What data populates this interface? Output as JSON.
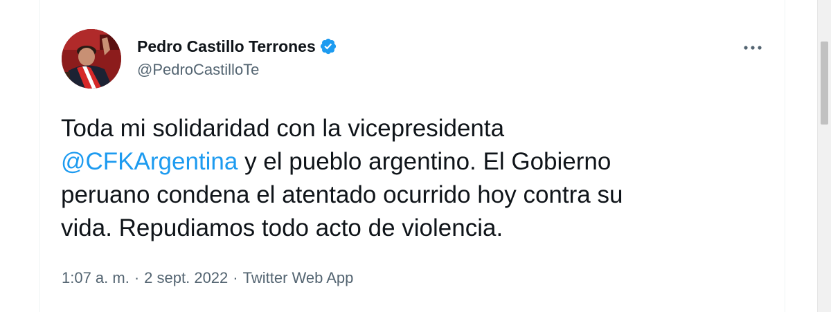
{
  "author": {
    "display_name": "Pedro Castillo Terrones",
    "handle": "@PedroCastilloTe",
    "verified": true
  },
  "tweet": {
    "text_line1": "Toda mi solidaridad con la vicepresidenta",
    "mention": "@CFKArgentina",
    "text_after_mention": " y el pueblo argentino. El Gobierno",
    "text_line3": "peruano condena el atentado ocurrido hoy contra su",
    "text_line4": "vida. Repudiamos todo acto de violencia."
  },
  "meta": {
    "time": "1:07 a. m.",
    "separator": "·",
    "date": "2 sept. 2022",
    "source": "Twitter Web App"
  },
  "icons": {
    "verified": "verified-badge-icon",
    "more": "more-options-icon"
  },
  "colors": {
    "accent": "#1d9bf0",
    "text_primary": "#0f1419",
    "text_secondary": "#536471"
  }
}
